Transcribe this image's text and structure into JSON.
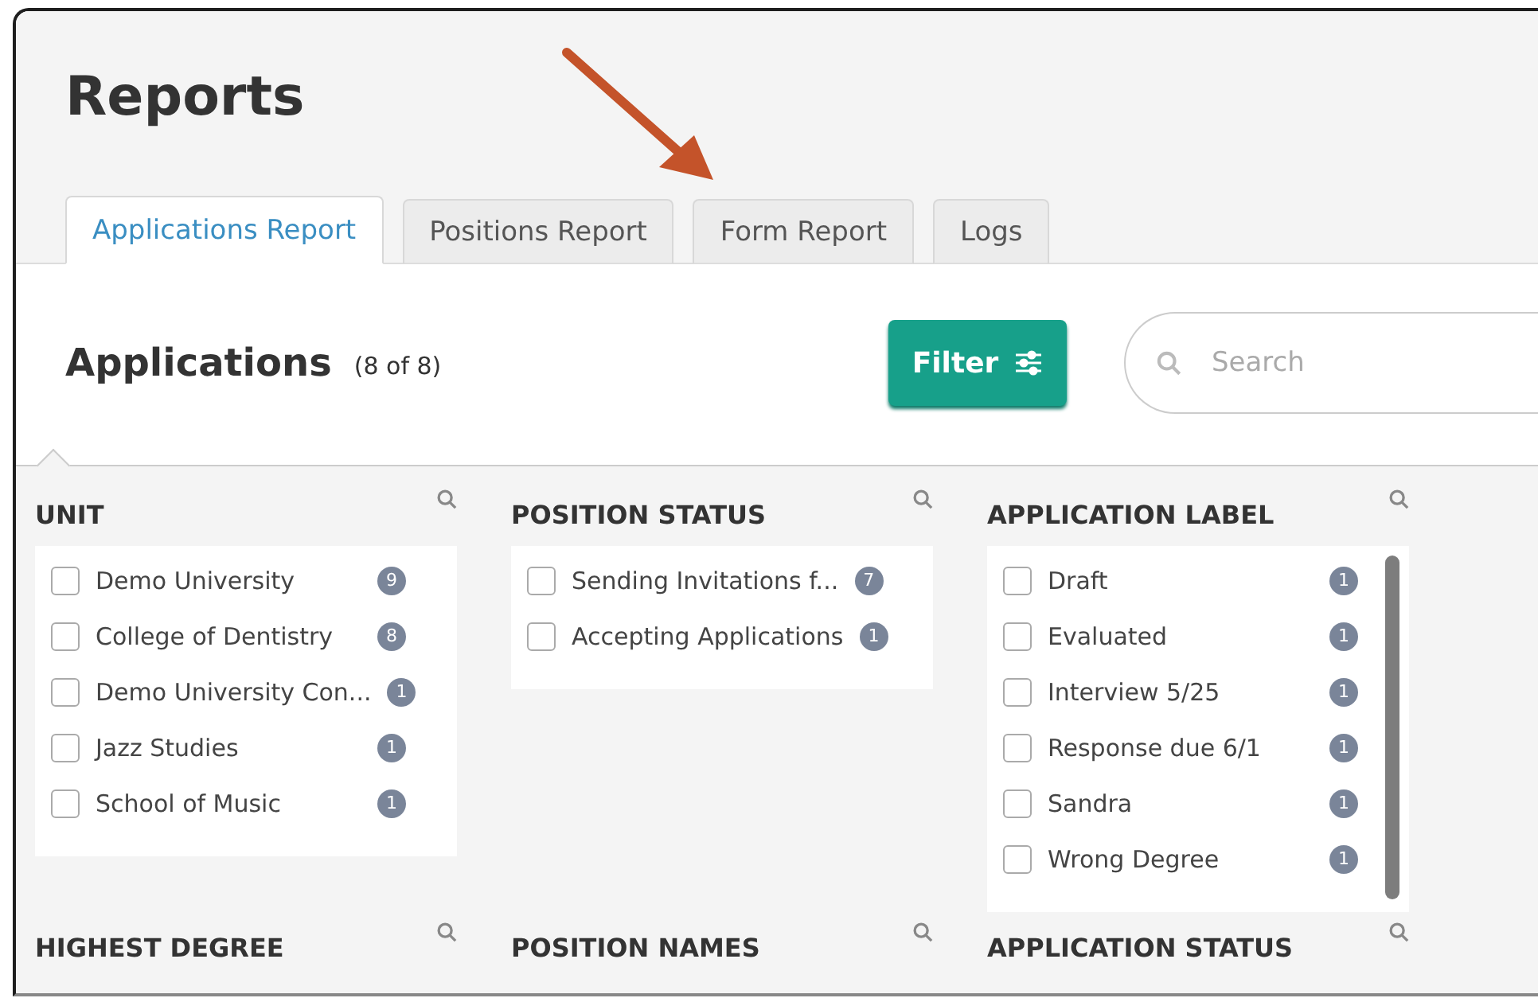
{
  "page_title": "Reports",
  "tabs": [
    {
      "label": "Applications Report",
      "selected": true
    },
    {
      "label": "Positions Report",
      "selected": false
    },
    {
      "label": "Form Report",
      "selected": false
    },
    {
      "label": "Logs",
      "selected": false
    }
  ],
  "section": {
    "title": "Applications",
    "count": "(8 of 8)"
  },
  "filter_button": "Filter",
  "search": {
    "placeholder": "Search"
  },
  "filter_groups": [
    {
      "title": "UNIT",
      "options": [
        {
          "label": "Demo University",
          "count": "9",
          "checked": false
        },
        {
          "label": "College of Dentistry",
          "count": "8",
          "checked": false
        },
        {
          "label": "Demo University Con...",
          "count": "1",
          "checked": false
        },
        {
          "label": "Jazz Studies",
          "count": "1",
          "checked": false
        },
        {
          "label": "School of Music",
          "count": "1",
          "checked": false
        }
      ]
    },
    {
      "title": "POSITION STATUS",
      "options": [
        {
          "label": "Sending Invitations f...",
          "count": "7",
          "checked": false
        },
        {
          "label": "Accepting Applications",
          "count": "1",
          "checked": false
        }
      ]
    },
    {
      "title": "APPLICATION LABEL",
      "options": [
        {
          "label": "Draft",
          "count": "1",
          "checked": false
        },
        {
          "label": "Evaluated",
          "count": "1",
          "checked": false
        },
        {
          "label": "Interview 5/25",
          "count": "1",
          "checked": false
        },
        {
          "label": "Response due 6/1",
          "count": "1",
          "checked": false
        },
        {
          "label": "Sandra",
          "count": "1",
          "checked": false
        },
        {
          "label": "Wrong Degree",
          "count": "1",
          "checked": false
        }
      ]
    },
    {
      "title": "HIGHEST DEGREE"
    },
    {
      "title": "POSITION NAMES"
    },
    {
      "title": "APPLICATION STATUS"
    }
  ]
}
